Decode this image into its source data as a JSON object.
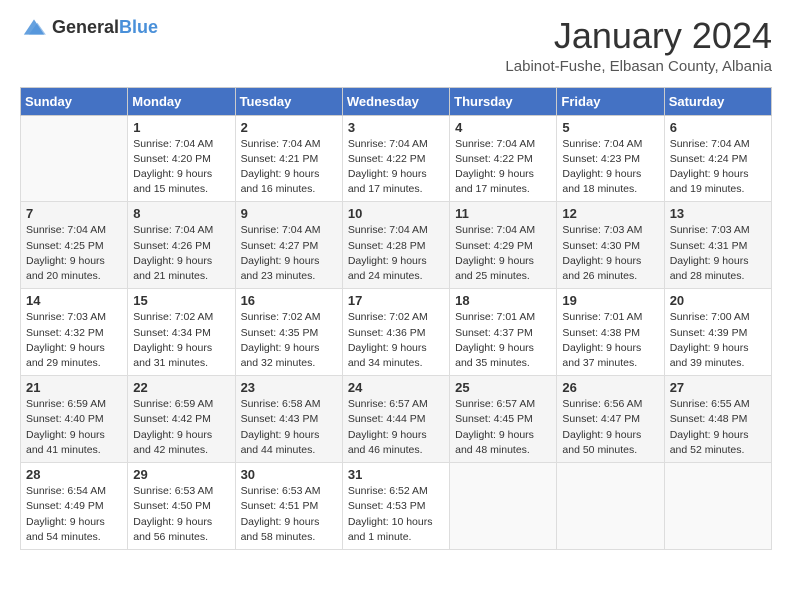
{
  "header": {
    "logo_general": "General",
    "logo_blue": "Blue",
    "month_title": "January 2024",
    "location": "Labinot-Fushe, Elbasan County, Albania"
  },
  "days_of_week": [
    "Sunday",
    "Monday",
    "Tuesday",
    "Wednesday",
    "Thursday",
    "Friday",
    "Saturday"
  ],
  "weeks": [
    [
      {
        "day": "",
        "sunrise": "",
        "sunset": "",
        "daylight": ""
      },
      {
        "day": "1",
        "sunrise": "Sunrise: 7:04 AM",
        "sunset": "Sunset: 4:20 PM",
        "daylight": "Daylight: 9 hours and 15 minutes."
      },
      {
        "day": "2",
        "sunrise": "Sunrise: 7:04 AM",
        "sunset": "Sunset: 4:21 PM",
        "daylight": "Daylight: 9 hours and 16 minutes."
      },
      {
        "day": "3",
        "sunrise": "Sunrise: 7:04 AM",
        "sunset": "Sunset: 4:22 PM",
        "daylight": "Daylight: 9 hours and 17 minutes."
      },
      {
        "day": "4",
        "sunrise": "Sunrise: 7:04 AM",
        "sunset": "Sunset: 4:22 PM",
        "daylight": "Daylight: 9 hours and 17 minutes."
      },
      {
        "day": "5",
        "sunrise": "Sunrise: 7:04 AM",
        "sunset": "Sunset: 4:23 PM",
        "daylight": "Daylight: 9 hours and 18 minutes."
      },
      {
        "day": "6",
        "sunrise": "Sunrise: 7:04 AM",
        "sunset": "Sunset: 4:24 PM",
        "daylight": "Daylight: 9 hours and 19 minutes."
      }
    ],
    [
      {
        "day": "7",
        "sunrise": "Sunrise: 7:04 AM",
        "sunset": "Sunset: 4:25 PM",
        "daylight": "Daylight: 9 hours and 20 minutes."
      },
      {
        "day": "8",
        "sunrise": "Sunrise: 7:04 AM",
        "sunset": "Sunset: 4:26 PM",
        "daylight": "Daylight: 9 hours and 21 minutes."
      },
      {
        "day": "9",
        "sunrise": "Sunrise: 7:04 AM",
        "sunset": "Sunset: 4:27 PM",
        "daylight": "Daylight: 9 hours and 23 minutes."
      },
      {
        "day": "10",
        "sunrise": "Sunrise: 7:04 AM",
        "sunset": "Sunset: 4:28 PM",
        "daylight": "Daylight: 9 hours and 24 minutes."
      },
      {
        "day": "11",
        "sunrise": "Sunrise: 7:04 AM",
        "sunset": "Sunset: 4:29 PM",
        "daylight": "Daylight: 9 hours and 25 minutes."
      },
      {
        "day": "12",
        "sunrise": "Sunrise: 7:03 AM",
        "sunset": "Sunset: 4:30 PM",
        "daylight": "Daylight: 9 hours and 26 minutes."
      },
      {
        "day": "13",
        "sunrise": "Sunrise: 7:03 AM",
        "sunset": "Sunset: 4:31 PM",
        "daylight": "Daylight: 9 hours and 28 minutes."
      }
    ],
    [
      {
        "day": "14",
        "sunrise": "Sunrise: 7:03 AM",
        "sunset": "Sunset: 4:32 PM",
        "daylight": "Daylight: 9 hours and 29 minutes."
      },
      {
        "day": "15",
        "sunrise": "Sunrise: 7:02 AM",
        "sunset": "Sunset: 4:34 PM",
        "daylight": "Daylight: 9 hours and 31 minutes."
      },
      {
        "day": "16",
        "sunrise": "Sunrise: 7:02 AM",
        "sunset": "Sunset: 4:35 PM",
        "daylight": "Daylight: 9 hours and 32 minutes."
      },
      {
        "day": "17",
        "sunrise": "Sunrise: 7:02 AM",
        "sunset": "Sunset: 4:36 PM",
        "daylight": "Daylight: 9 hours and 34 minutes."
      },
      {
        "day": "18",
        "sunrise": "Sunrise: 7:01 AM",
        "sunset": "Sunset: 4:37 PM",
        "daylight": "Daylight: 9 hours and 35 minutes."
      },
      {
        "day": "19",
        "sunrise": "Sunrise: 7:01 AM",
        "sunset": "Sunset: 4:38 PM",
        "daylight": "Daylight: 9 hours and 37 minutes."
      },
      {
        "day": "20",
        "sunrise": "Sunrise: 7:00 AM",
        "sunset": "Sunset: 4:39 PM",
        "daylight": "Daylight: 9 hours and 39 minutes."
      }
    ],
    [
      {
        "day": "21",
        "sunrise": "Sunrise: 6:59 AM",
        "sunset": "Sunset: 4:40 PM",
        "daylight": "Daylight: 9 hours and 41 minutes."
      },
      {
        "day": "22",
        "sunrise": "Sunrise: 6:59 AM",
        "sunset": "Sunset: 4:42 PM",
        "daylight": "Daylight: 9 hours and 42 minutes."
      },
      {
        "day": "23",
        "sunrise": "Sunrise: 6:58 AM",
        "sunset": "Sunset: 4:43 PM",
        "daylight": "Daylight: 9 hours and 44 minutes."
      },
      {
        "day": "24",
        "sunrise": "Sunrise: 6:57 AM",
        "sunset": "Sunset: 4:44 PM",
        "daylight": "Daylight: 9 hours and 46 minutes."
      },
      {
        "day": "25",
        "sunrise": "Sunrise: 6:57 AM",
        "sunset": "Sunset: 4:45 PM",
        "daylight": "Daylight: 9 hours and 48 minutes."
      },
      {
        "day": "26",
        "sunrise": "Sunrise: 6:56 AM",
        "sunset": "Sunset: 4:47 PM",
        "daylight": "Daylight: 9 hours and 50 minutes."
      },
      {
        "day": "27",
        "sunrise": "Sunrise: 6:55 AM",
        "sunset": "Sunset: 4:48 PM",
        "daylight": "Daylight: 9 hours and 52 minutes."
      }
    ],
    [
      {
        "day": "28",
        "sunrise": "Sunrise: 6:54 AM",
        "sunset": "Sunset: 4:49 PM",
        "daylight": "Daylight: 9 hours and 54 minutes."
      },
      {
        "day": "29",
        "sunrise": "Sunrise: 6:53 AM",
        "sunset": "Sunset: 4:50 PM",
        "daylight": "Daylight: 9 hours and 56 minutes."
      },
      {
        "day": "30",
        "sunrise": "Sunrise: 6:53 AM",
        "sunset": "Sunset: 4:51 PM",
        "daylight": "Daylight: 9 hours and 58 minutes."
      },
      {
        "day": "31",
        "sunrise": "Sunrise: 6:52 AM",
        "sunset": "Sunset: 4:53 PM",
        "daylight": "Daylight: 10 hours and 1 minute."
      },
      {
        "day": "",
        "sunrise": "",
        "sunset": "",
        "daylight": ""
      },
      {
        "day": "",
        "sunrise": "",
        "sunset": "",
        "daylight": ""
      },
      {
        "day": "",
        "sunrise": "",
        "sunset": "",
        "daylight": ""
      }
    ]
  ]
}
